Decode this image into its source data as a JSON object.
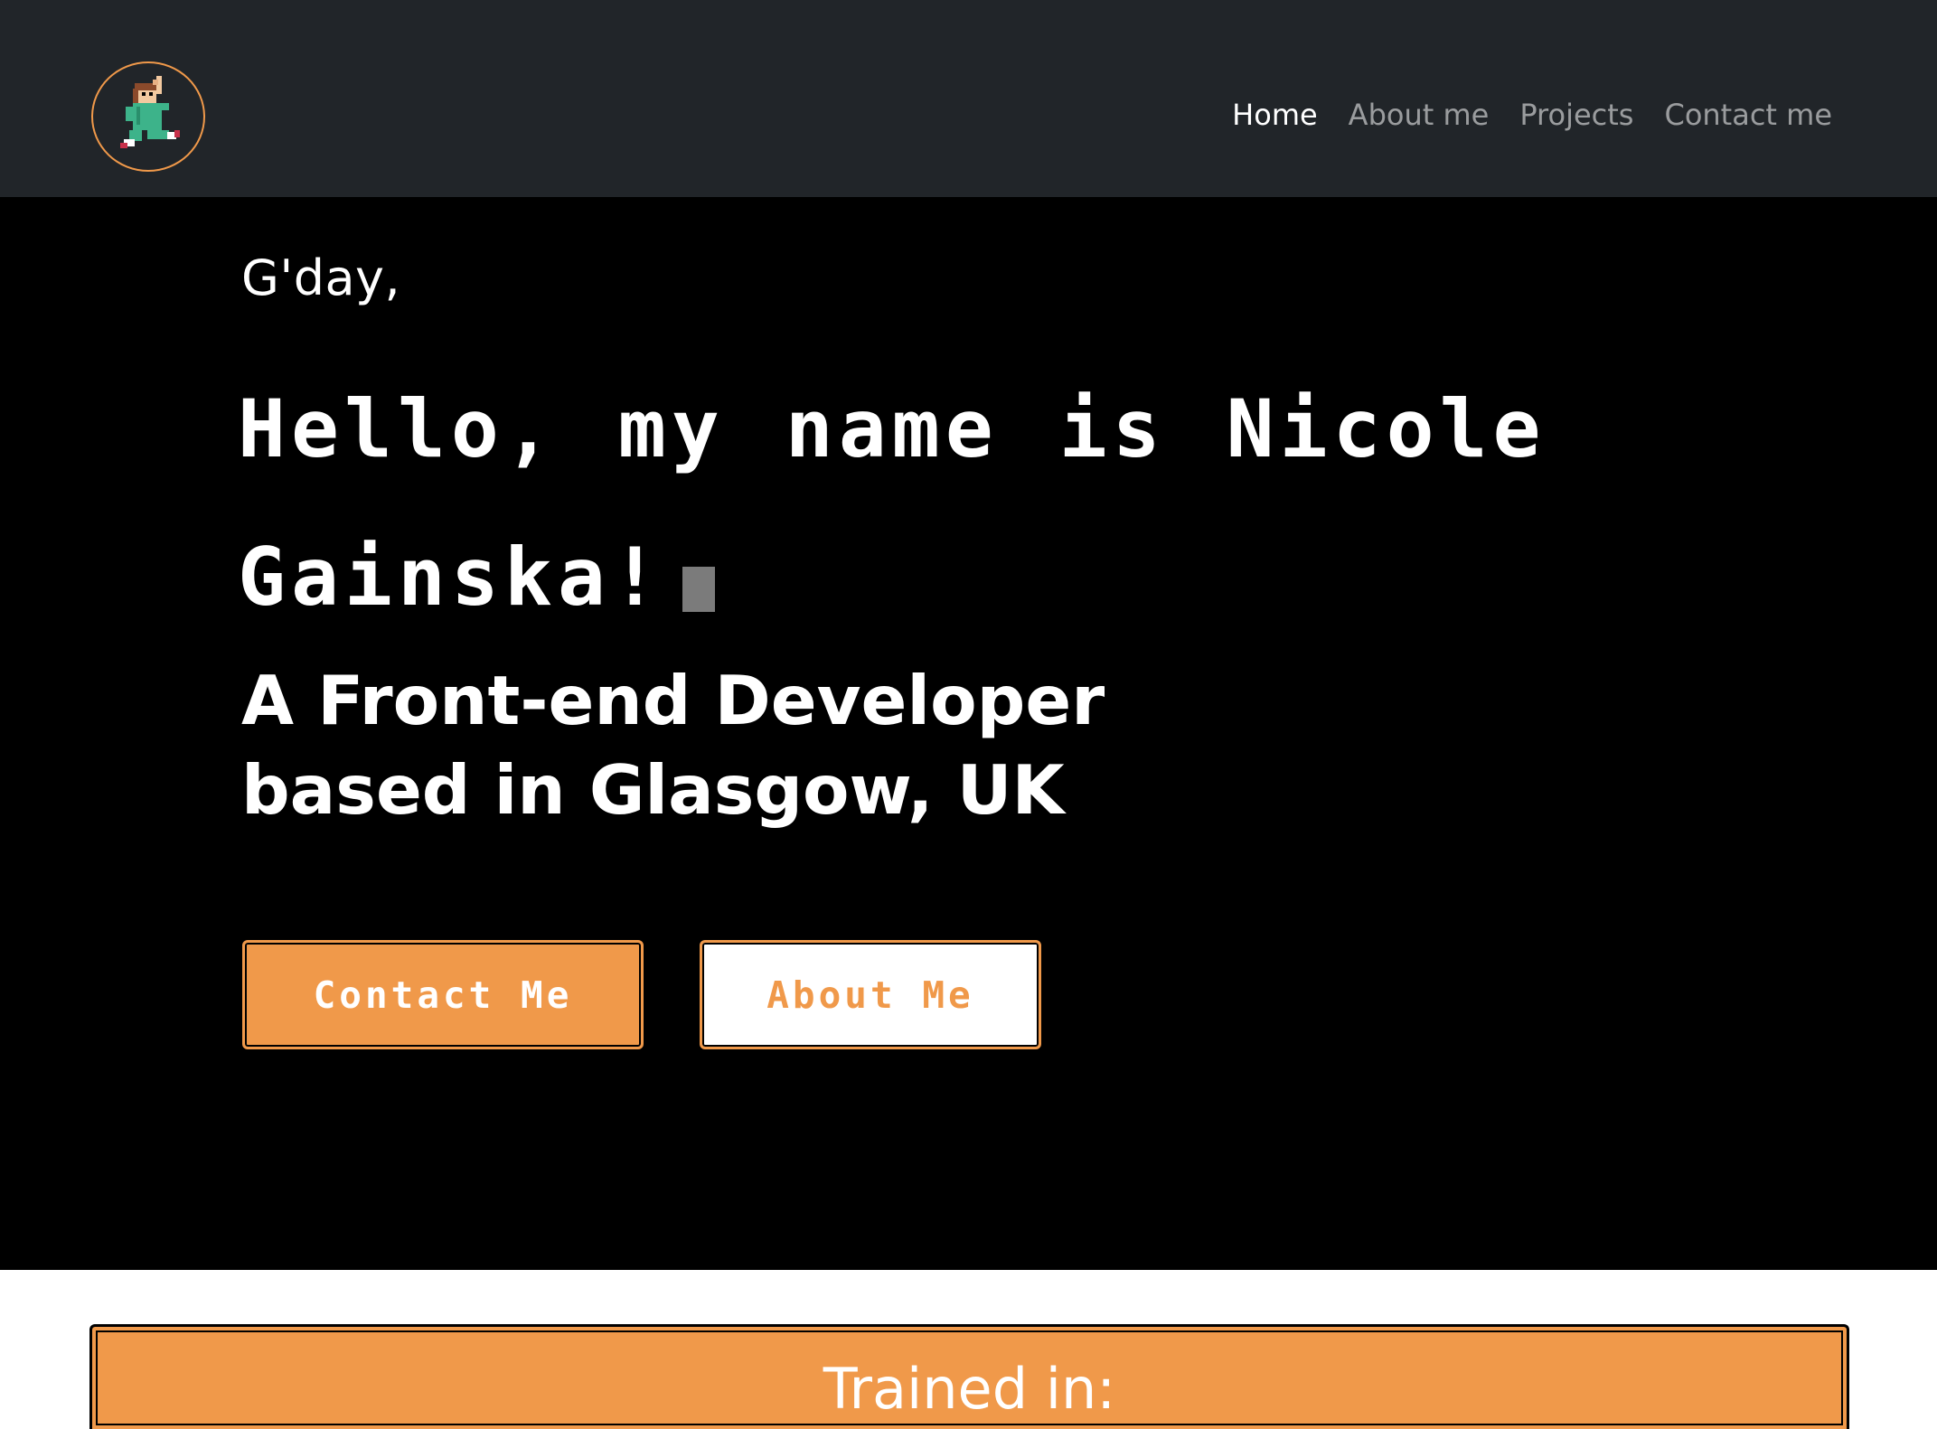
{
  "navbar": {
    "logo_alt": "pixel character logo",
    "links": [
      {
        "label": "Home",
        "active": true
      },
      {
        "label": "About me",
        "active": false
      },
      {
        "label": "Projects",
        "active": false
      },
      {
        "label": "Contact me",
        "active": false
      }
    ]
  },
  "hero": {
    "greeting": "G'day,",
    "headline": "Hello, my name is Nicole Gainska!",
    "tagline_line1": "A Front-end Developer",
    "tagline_line2": "based in Glasgow, UK",
    "contact_button": "Contact Me",
    "about_button": "About Me"
  },
  "trained": {
    "title": "Trained in:"
  },
  "colors": {
    "accent": "#f0994a",
    "navbar_bg": "#212529",
    "hero_bg": "#000000",
    "text_light": "#ffffff",
    "nav_muted": "rgba(255,255,255,0.55)",
    "cursor": "#7b7b7b"
  }
}
